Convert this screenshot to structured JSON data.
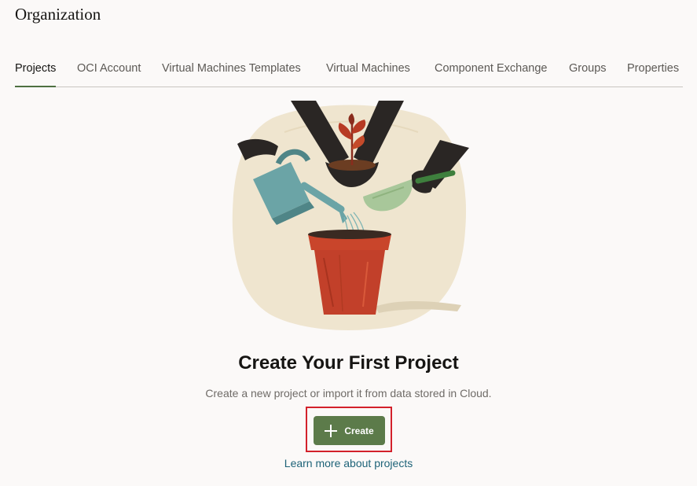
{
  "page": {
    "title": "Organization"
  },
  "tabs": [
    {
      "label": "Projects",
      "active": true
    },
    {
      "label": "OCI Account",
      "active": false
    },
    {
      "label": "Virtual Machines Templates",
      "active": false
    },
    {
      "label": "Virtual Machines",
      "active": false
    },
    {
      "label": "Component Exchange",
      "active": false
    },
    {
      "label": "Groups",
      "active": false
    },
    {
      "label": "Properties",
      "active": false
    }
  ],
  "empty_state": {
    "illustration_icon": "hands-watering-plant-illustration",
    "heading": "Create Your First Project",
    "description": "Create a new project or import it from data stored in Cloud.",
    "create_button_label": "Create",
    "create_button_icon": "plus-icon",
    "learn_more_link": "Learn more about projects"
  },
  "colors": {
    "accent": "#5c7b4a",
    "active_tab_underline": "#4d7041",
    "link": "#1e6378",
    "highlight": "#d3212b"
  }
}
